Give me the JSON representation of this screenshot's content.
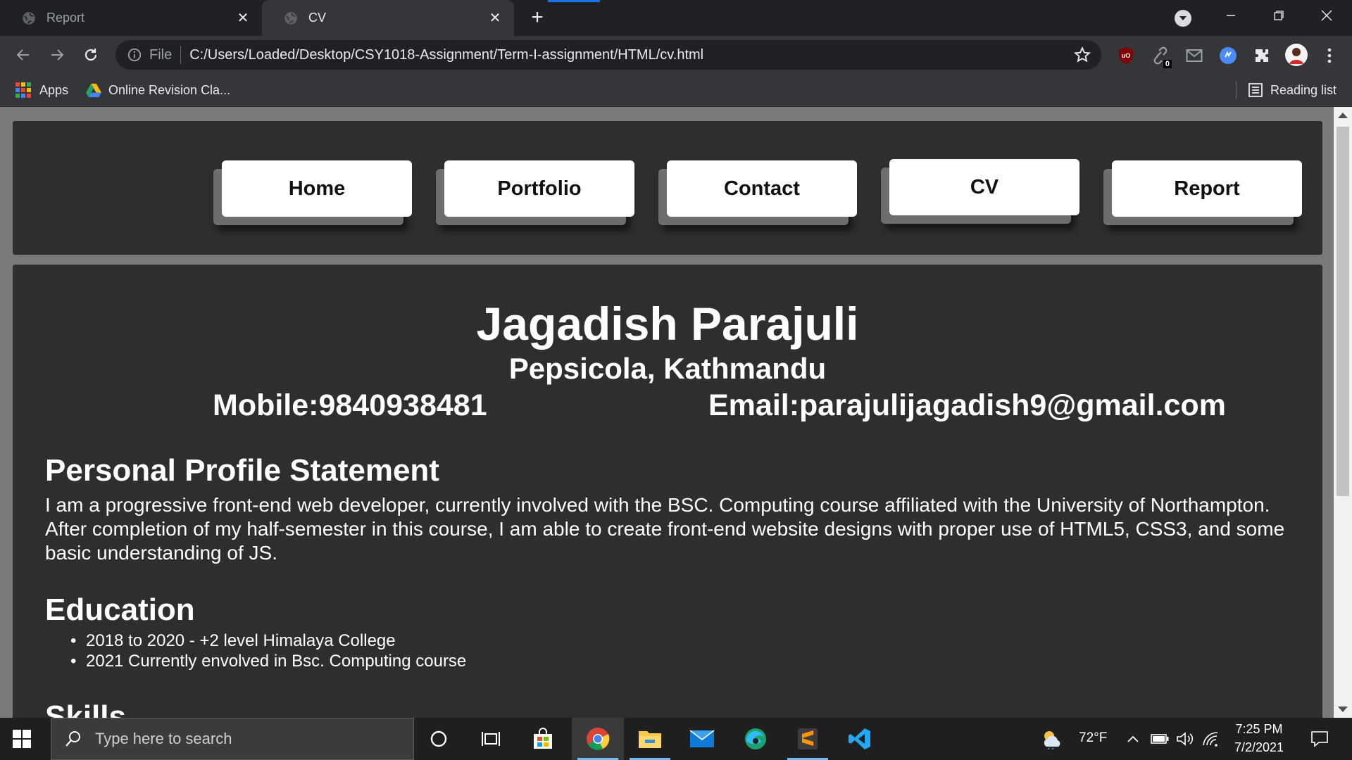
{
  "browser": {
    "tabs": [
      {
        "title": "Report",
        "active": false
      },
      {
        "title": "CV",
        "active": true
      }
    ],
    "address": {
      "scheme": "File",
      "url": "C:/Users/Loaded/Desktop/CSY1018-Assignment/Term-I-assignment/HTML/cv.html"
    },
    "extension_badge": "0",
    "bookmarks": [
      {
        "label": "Apps",
        "icon": "apps-grid-icon"
      },
      {
        "label": "Online Revision Cla...",
        "icon": "google-drive-icon"
      }
    ],
    "reading_list": "Reading list"
  },
  "site_nav": {
    "items": [
      {
        "label": "Home"
      },
      {
        "label": "Portfolio"
      },
      {
        "label": "Contact"
      },
      {
        "label": "CV",
        "active": true
      },
      {
        "label": "Report"
      }
    ]
  },
  "cv": {
    "name": "Jagadish Parajuli",
    "address": "Pepsicola, Kathmandu",
    "mobile": "Mobile:9840938481",
    "email": "Email:parajulijagadish9@gmail.com",
    "profile_heading": "Personal Profile Statement",
    "profile_text": "I am a progressive front-end web developer, currently involved with the BSC. Computing course affiliated with the University of Northampton. After completion of my half-semester in this course, I am able to create front-end website designs with proper use of HTML5, CSS3, and some basic understanding of JS.",
    "education_heading": "Education",
    "education": [
      "2018 to 2020 - +2 level Himalaya College",
      "2021 Currently envolved in Bsc. Computing course"
    ],
    "skills_heading": "Skills"
  },
  "taskbar": {
    "search_placeholder": "Type here to search",
    "weather": "72°F",
    "time": "7:25 PM",
    "date": "7/2/2021"
  },
  "colors": {
    "page_bg": "#7a7a7a",
    "panel_bg": "#2e2e2e",
    "nav_button": "#ffffff",
    "chrome_dark": "#202124",
    "chrome_toolbar": "#35363a"
  }
}
